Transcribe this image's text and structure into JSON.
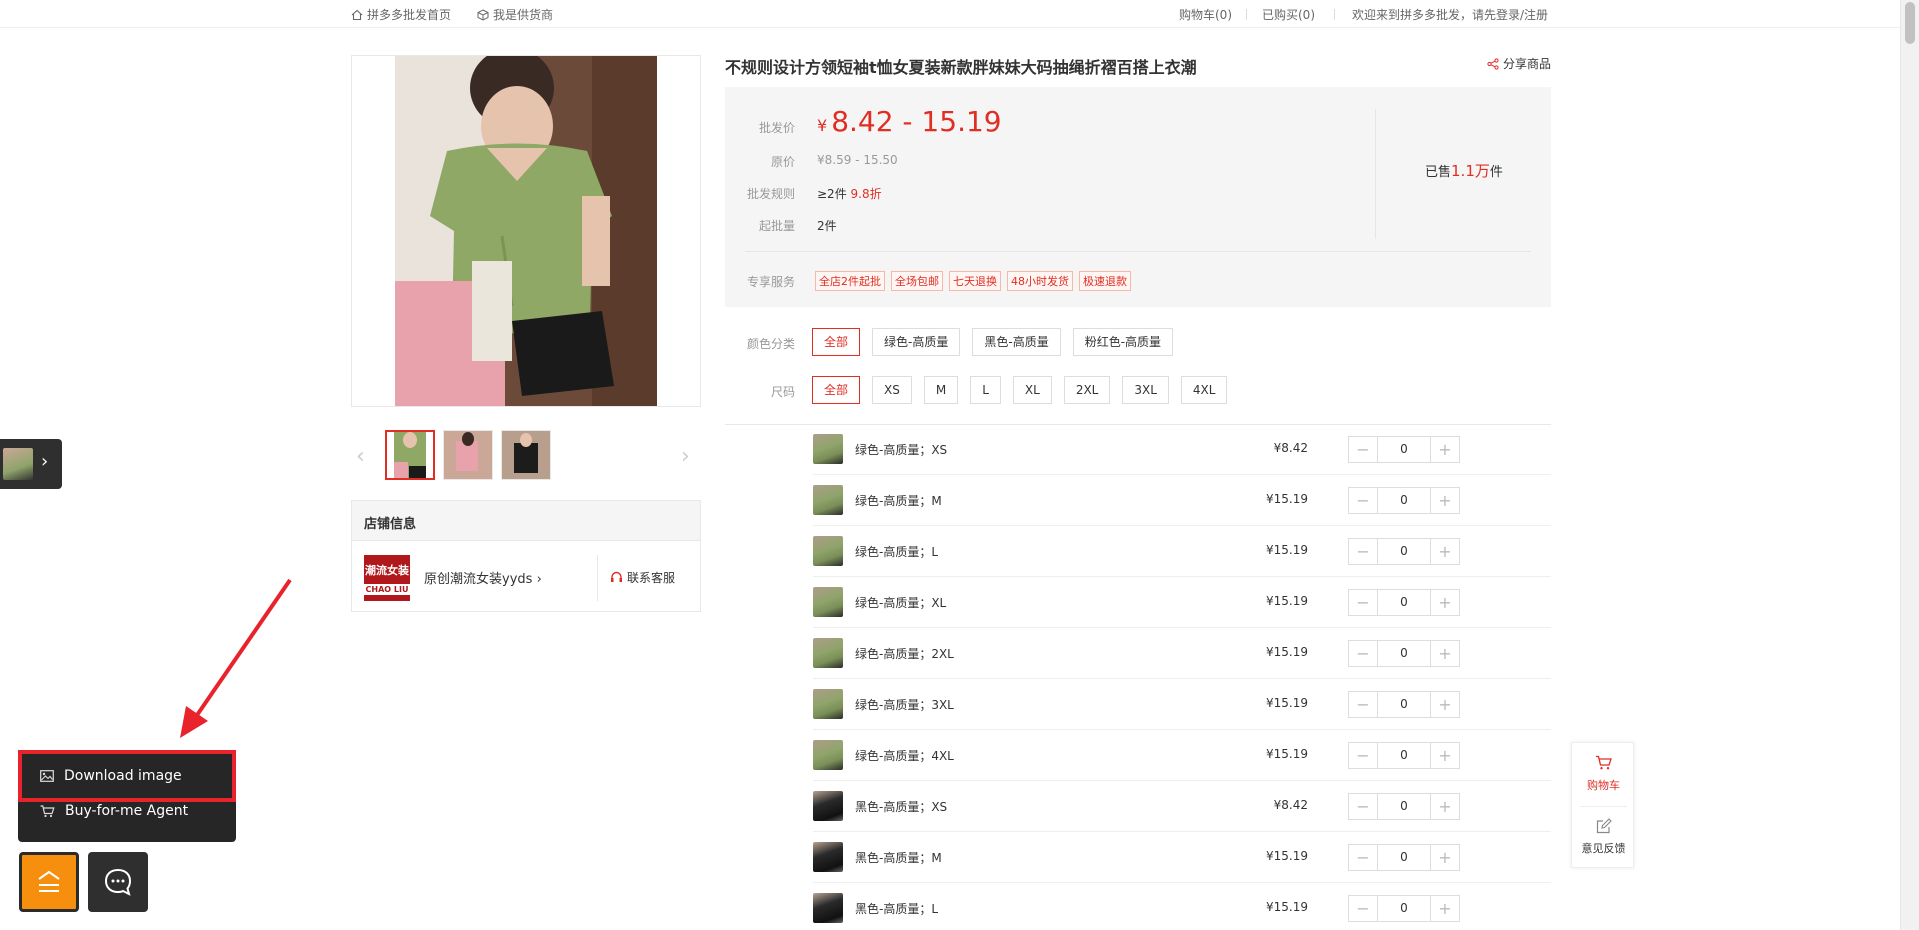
{
  "topbar": {
    "home": "拼多多批发首页",
    "supplier": "我是供货商",
    "cart": "购物车(0)",
    "bought": "已购买(0)",
    "welcome": "欢迎来到拼多多批发，请先登录/注册"
  },
  "product": {
    "title": "不规则设计方领短袖t恤女夏装新款胖妹妹大码抽绳折褶百搭上衣潮",
    "share": "分享商品"
  },
  "price": {
    "wholesale_label": "批发价",
    "currency": "¥",
    "wholesale_range": "8.42 - 15.19",
    "original_label": "原价",
    "original_range": "¥8.59 - 15.50",
    "rule_label": "批发规则",
    "rule_qty": "≥2件",
    "rule_discount": "9.8折",
    "min_label": "起批量",
    "min_value": "2件",
    "sold_prefix": "已售",
    "sold_num": "1.1万",
    "sold_suffix": "件",
    "service_label": "专享服务",
    "services": [
      "全店2件起批",
      "全场包邮",
      "七天退换",
      "48小时发货",
      "极速退款"
    ]
  },
  "options": {
    "color_label": "颜色分类",
    "colors": [
      "全部",
      "绿色-高质量",
      "黑色-高质量",
      "粉红色-高质量"
    ],
    "size_label": "尺码",
    "sizes": [
      "全部",
      "XS",
      "M",
      "L",
      "XL",
      "2XL",
      "3XL",
      "4XL"
    ]
  },
  "skus": [
    {
      "name": "绿色-高质量；XS",
      "price": "¥8.42",
      "qty": "0",
      "swatch": "green"
    },
    {
      "name": "绿色-高质量；M",
      "price": "¥15.19",
      "qty": "0",
      "swatch": "green"
    },
    {
      "name": "绿色-高质量；L",
      "price": "¥15.19",
      "qty": "0",
      "swatch": "green"
    },
    {
      "name": "绿色-高质量；XL",
      "price": "¥15.19",
      "qty": "0",
      "swatch": "green"
    },
    {
      "name": "绿色-高质量；2XL",
      "price": "¥15.19",
      "qty": "0",
      "swatch": "green"
    },
    {
      "name": "绿色-高质量；3XL",
      "price": "¥15.19",
      "qty": "0",
      "swatch": "green"
    },
    {
      "name": "绿色-高质量；4XL",
      "price": "¥15.19",
      "qty": "0",
      "swatch": "green"
    },
    {
      "name": "黑色-高质量；XS",
      "price": "¥8.42",
      "qty": "0",
      "swatch": "black"
    },
    {
      "name": "黑色-高质量；M",
      "price": "¥15.19",
      "qty": "0",
      "swatch": "black"
    },
    {
      "name": "黑色-高质量；L",
      "price": "¥15.19",
      "qty": "0",
      "swatch": "black"
    }
  ],
  "shop": {
    "header": "店铺信息",
    "logo_line1": "潮流女装",
    "logo_line2": "CHAO LIU",
    "name": "原创潮流女装yyds",
    "contact": "联系客服"
  },
  "popup": {
    "download": "Download image",
    "agent": "Buy-for-me Agent"
  },
  "side": {
    "cart": "购物车",
    "feedback": "意见反馈"
  },
  "colors": {
    "accent": "#e02e24",
    "highlight": "#e8232c",
    "orange": "#f78f0e"
  }
}
